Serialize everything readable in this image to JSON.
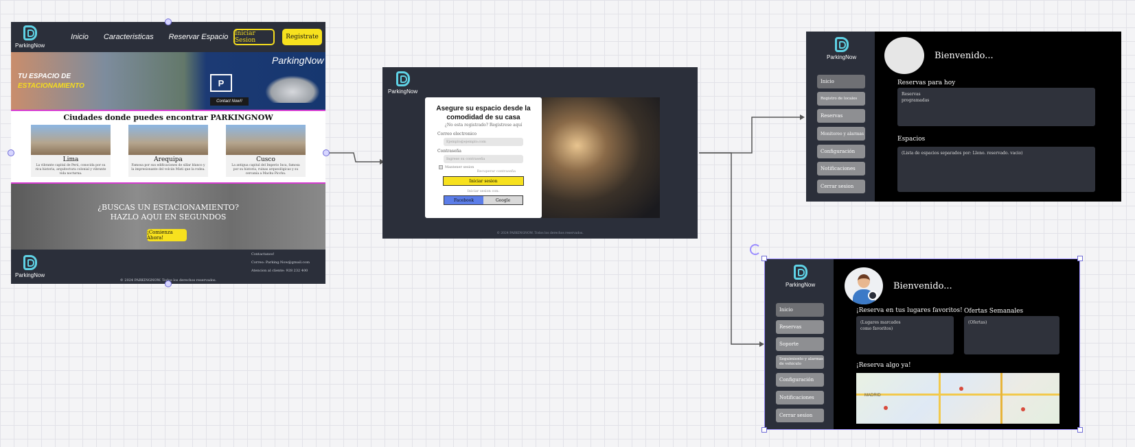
{
  "landing": {
    "logo_text": "ParkingNow",
    "nav": [
      "Inicio",
      "Caracteristicas",
      "Reservar Espacio"
    ],
    "login_button": "Iniciar Sesion",
    "register_button": "Registrate",
    "hero": {
      "tag_line_1": "TU ESPACIO DE",
      "tag_line_2": "ESTACIONAMIENTO",
      "brand": "ParkingNow",
      "parking_sign": "P",
      "contact": "Contact Now!!"
    },
    "cities_title": "Ciudades donde puedes encontrar PARKINGNOW",
    "cities": [
      {
        "name": "Lima",
        "desc": "La vibrante capital de Perú, conocida por su rica historia, arquitectura colonial y vibrante vida nocturna."
      },
      {
        "name": "Arequipa",
        "desc": "Famosa por sus edificaciones de sillar blanco y la impresionante del volcán Misti que la rodea."
      },
      {
        "name": "Cusco",
        "desc": "La antigua capital del Imperio Inca, famosa por su historia, ruinas arqueológicas y su cercanía a Machu Picchu."
      }
    ],
    "promo_line_1": "¿BUSCAS UN ESTACIONAMIENTO?",
    "promo_line_2": "HAZLO AQUI EN SEGUNDOS",
    "promo_button": "¡Comienza Ahora!",
    "footer": {
      "contact_title": "Contactanos!",
      "email": "Correo: Parking.Now@gmail.com",
      "phone": "Atencion al cliente: 928 232 400",
      "copyright": "© 2024 PARKINGNOW. Todos los derechos reservados."
    }
  },
  "login": {
    "logo_text": "ParkingNow",
    "title": "Asegure su espacio desde la comodidad de su casa",
    "register_prompt": "¿No esta registrado? Registrese aquí",
    "email_label": "Correo electronico",
    "email_placeholder": "Ejemplo@ejemplo.com",
    "password_label": "Contraseña",
    "password_placeholder": "Ingrese su contraseña",
    "remember": "Mantener sesion",
    "forgot": "Recuperar contraseña",
    "signin_button": "Iniciar sesion",
    "or_label": "Iniciar sesion con:",
    "facebook": "Facebook",
    "google": "Google",
    "footnote": "© 2024 PARKINGNOW. Todos los derechos reservados."
  },
  "admin": {
    "logo_text": "ParkingNow",
    "menu": [
      "Inicio",
      "Registro de locales",
      "Reservas",
      "Monitoreo y alarmas",
      "Configuración",
      "Notificaciones",
      "Cerrar sesion"
    ],
    "welcome": "Bienvenido...",
    "today_title": "Reservas para hoy",
    "today_content": "Reservas\nprogramadas",
    "spaces_title": "Espacios",
    "spaces_content": "(Lista de espacios separados por: Lleno. reservado. vacio)"
  },
  "user": {
    "logo_text": "ParkingNow",
    "menu": [
      "Inicio",
      "Reservas",
      "Soporte",
      "Seguimiento y alarmas de vehiculo",
      "Configuración",
      "Notificaciones",
      "Cerrar sesion"
    ],
    "welcome": "Bienvenido...",
    "favorites_title": "¡Reserva en tus lugares favoritos!",
    "favorites_content": "(Lugares marcados\ncomo favoritos)",
    "offers_title": "Ofertas Semanales",
    "offers_content": "(Ofertas)",
    "book_title": "¡Reserva algo ya!",
    "map_label": "MADRID"
  },
  "colors": {
    "frame": "#2b2f3a",
    "accent_yellow": "#f7e11e",
    "selection": "#6f6bd6",
    "magenta_divider": "#d63bd1"
  }
}
